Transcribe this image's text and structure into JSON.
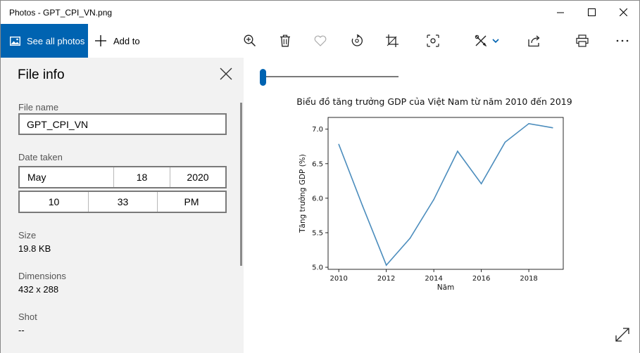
{
  "window": {
    "title": "Photos - GPT_CPI_VN.png"
  },
  "toolbar": {
    "see_all_label": "See all photos",
    "add_to_label": "Add to",
    "icons": [
      "zoom-in-icon",
      "delete-icon",
      "favorite-icon",
      "rotate-icon",
      "crop-icon",
      "enhance-icon",
      "edit-icon",
      "chevron-down-icon",
      "share-icon",
      "print-icon",
      "more-icon"
    ]
  },
  "info": {
    "title": "File info",
    "file_name_label": "File name",
    "file_name": "GPT_CPI_VN",
    "date_taken_label": "Date taken",
    "date": {
      "month": "May",
      "day": "18",
      "year": "2020"
    },
    "time": {
      "hour": "10",
      "minute": "33",
      "ampm": "PM"
    },
    "size_label": "Size",
    "size": "19.8 KB",
    "dimensions_label": "Dimensions",
    "dimensions": "432 x 288",
    "shot_label": "Shot",
    "shot": "--"
  },
  "colors": {
    "accent": "#0063b1",
    "panel_bg": "#f2f2f2",
    "line": "#4c8dbd"
  },
  "chart_data": {
    "type": "line",
    "title": "Biểu đồ tăng trưởng GDP của Việt Nam từ năm 2010 đến 2019",
    "xlabel": "Năm",
    "ylabel": "Tăng trưởng GDP (%)",
    "x": [
      2010,
      2011,
      2012,
      2013,
      2014,
      2015,
      2016,
      2017,
      2018,
      2019
    ],
    "values": [
      6.78,
      5.89,
      5.03,
      5.42,
      5.98,
      6.68,
      6.21,
      6.81,
      7.08,
      7.02
    ],
    "xticks": [
      "2010",
      "2012",
      "2014",
      "2016",
      "2018"
    ],
    "yticks": [
      "5.0",
      "5.5",
      "6.0",
      "6.5",
      "7.0"
    ],
    "xlim": [
      2009.55,
      2019.45
    ],
    "ylim": [
      4.97,
      7.17
    ],
    "grid": false
  }
}
